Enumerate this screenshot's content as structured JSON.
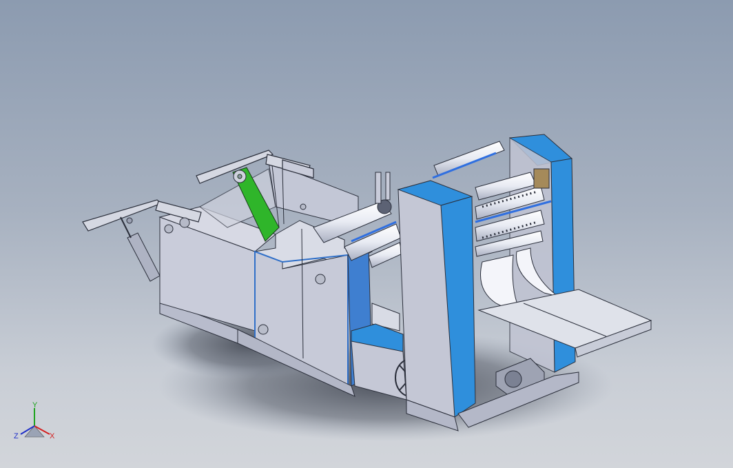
{
  "view": {
    "colors": {
      "background_top": "#8c9bb0",
      "background_bottom": "#d2d5da",
      "panel_gray": "#c9ccda",
      "panel_blue": "#2f8fdc",
      "guard_green": "#2fb52a",
      "roller_white": "#eef0f6",
      "edge": "#2a2e3a"
    }
  },
  "triad": {
    "x_label": "X",
    "y_label": "Y",
    "z_label": "Z",
    "x_color": "#d32020",
    "y_color": "#1fa31f",
    "z_color": "#2030c8"
  }
}
